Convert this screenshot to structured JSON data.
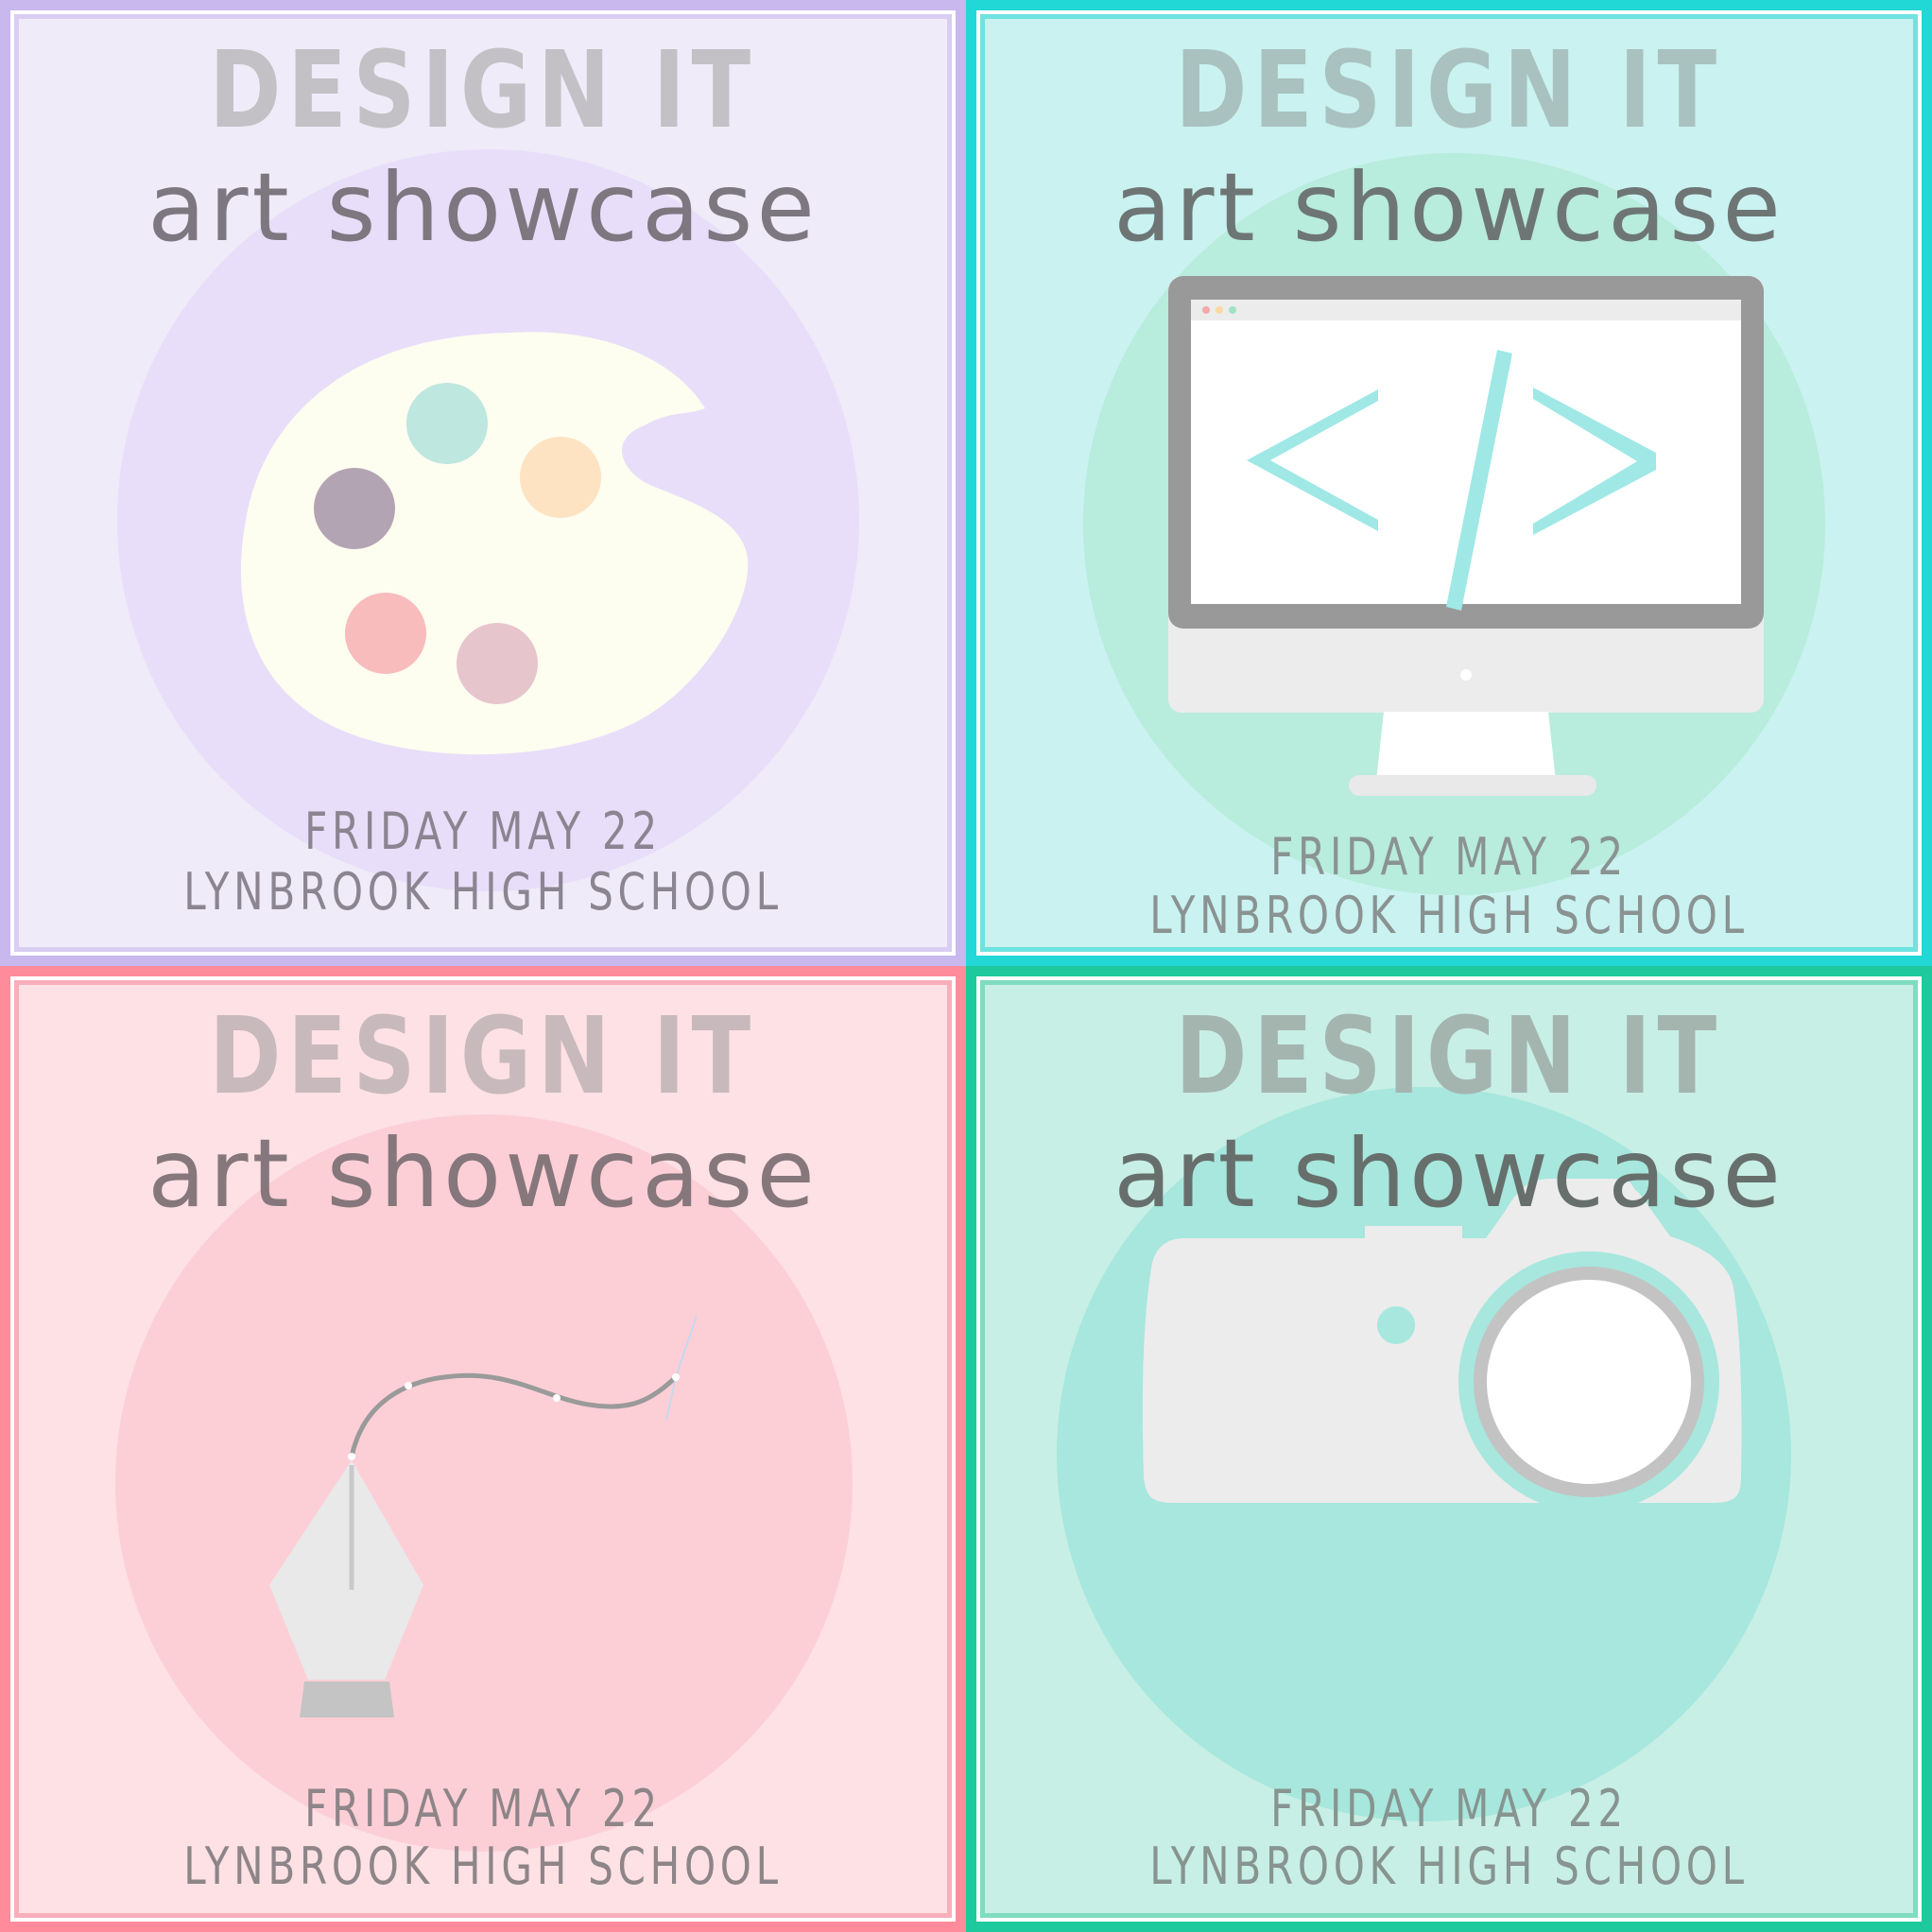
{
  "panels": [
    {
      "id": "painting",
      "title": "DESIGN IT",
      "subtitle": "art showcase",
      "date": "FRIDAY MAY 22",
      "school": "LYNBROOK HIGH SCHOOL",
      "icon": "palette-icon",
      "colors": {
        "border": "#c8b8ee",
        "inner_border": "#d9cdf4",
        "background": "#efebf8",
        "circle": "#e8def9",
        "title": "#c3c0c6",
        "subtitle": "#7d7780",
        "info": "#8a8590"
      }
    },
    {
      "id": "web",
      "title": "DESIGN IT",
      "subtitle": "art showcase",
      "date": "FRIDAY MAY 22",
      "school": "LYNBROOK HIGH SCHOOL",
      "icon": "computer-code-icon",
      "colors": {
        "border": "#22d8d6",
        "inner_border": "#6ee3df",
        "background": "#c9f2f0",
        "circle": "#b8ecdc",
        "title": "#a9c2bf",
        "subtitle": "#6e7675",
        "info": "#8a9392"
      }
    },
    {
      "id": "drawing",
      "title": "DESIGN IT",
      "subtitle": "art showcase",
      "date": "FRIDAY MAY 22",
      "school": "LYNBROOK HIGH SCHOOL",
      "icon": "pen-tool-icon",
      "colors": {
        "border": "#ff8b9b",
        "inner_border": "#f9aeb9",
        "background": "#fde1e5",
        "circle": "#fccfd7",
        "title": "#c8b9bc",
        "subtitle": "#85777b",
        "info": "#8e8588"
      }
    },
    {
      "id": "photography",
      "title": "DESIGN IT",
      "subtitle": "art showcase",
      "date": "FRIDAY MAY 22",
      "school": "LYNBROOK HIGH SCHOOL",
      "icon": "camera-icon",
      "colors": {
        "border": "#1ec99e",
        "inner_border": "#7fdcc0",
        "background": "#c8efe5",
        "circle": "#a7e7dd",
        "title": "#a4b5b0",
        "subtitle": "#676f6c",
        "info": "#879490"
      }
    }
  ]
}
